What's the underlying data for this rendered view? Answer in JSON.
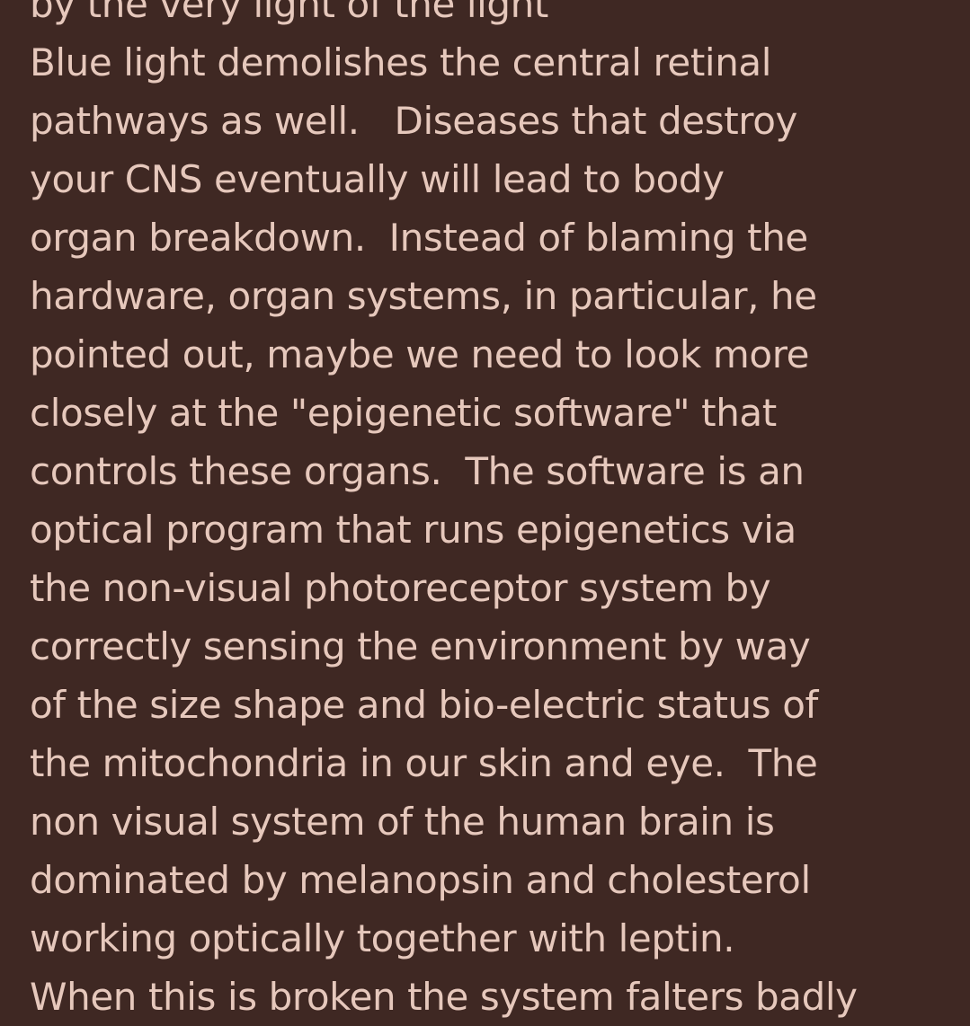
{
  "post": {
    "lines": [
      "by the very light of the light",
      "Blue light demolishes the central retinal",
      "pathways as well.   Diseases that destroy",
      "your CNS eventually will lead to body",
      "organ breakdown.  Instead of blaming the",
      "hardware, organ systems, in particular, he",
      "pointed out, maybe we need to look more",
      "closely at the \"epigenetic software\" that",
      "controls these organs.  The software is an",
      "optical program that runs epigenetics via",
      "the non-visual photoreceptor system by",
      "correctly sensing the environment by way",
      "of the size shape and bio-electric status of",
      "the mitochondria in our skin and eye.  The",
      "non visual system of the human brain is",
      "dominated by melanopsin and cholesterol",
      "working optically together with leptin.",
      "When this is broken the system falters badly"
    ]
  },
  "colors": {
    "background": "#3f2823",
    "text": "#e6c8bc"
  }
}
